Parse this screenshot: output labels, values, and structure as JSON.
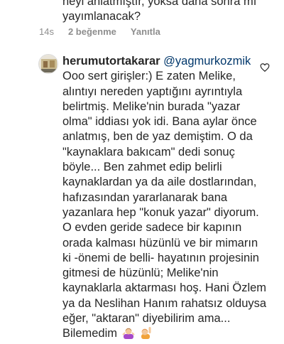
{
  "previous_comment": {
    "lines": [
      "neyi anlatmıştır, yoksa daha sonra mı",
      "yayımlanacak?"
    ],
    "time": "14s",
    "likes": "2 beğenme",
    "reply_label": "Yanıtla"
  },
  "reply": {
    "username": "herumutortakarar",
    "mention": "@yagmurkozmik",
    "first_line_rest": "",
    "lines": [
      "Ooo sert girişler:) E zaten Melike,",
      "alıntıyı nereden yaptığını ayrıntıyla",
      "belirtmiş. Melike'nin burada \"yazar",
      "olma\" iddiası yok idi. Bana aylar önce",
      "anlatmış, ben de yaz demiştim. O da",
      "\"kaynaklara bakıcam\" dedi sonuç",
      "böyle... Ben zahmet edip belirli",
      "kaynaklardan ya da aile dostlarından,",
      "hafızasından yararlanarak bana",
      "yazanlara hep \"konuk yazar\" diyorum.",
      "O evden geride sadece bir kapının",
      "orada kalması hüzünlü ve bir mimarın",
      "ki -önemi de belli- hayatının projesinin",
      "gitmesi de hüzünlü; Melike'nin",
      "kaynaklarla aktarması hoş. Hani Özlem",
      "ya da Neslihan Hanım rahatsız olduysa",
      "eğer, \"aktaran\" diyebilirim ama...",
      "Bilemedim"
    ],
    "emojis": [
      "person-shrugging-emoji",
      "person-raising-hand-emoji"
    ]
  }
}
